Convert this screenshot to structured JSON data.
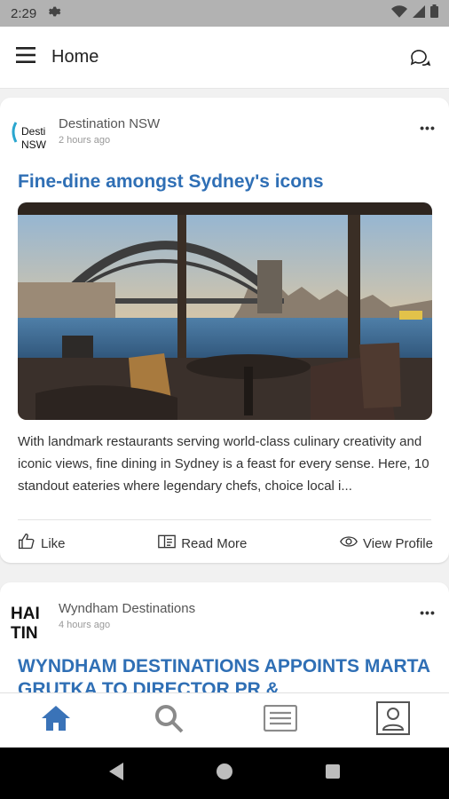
{
  "status_bar": {
    "time": "2:29"
  },
  "app_bar": {
    "title": "Home"
  },
  "feed": {
    "posts": [
      {
        "source": "Destination NSW",
        "logo_text": [
          "Desti",
          "NSW"
        ],
        "time": "2 hours ago",
        "title": "Fine-dine amongst Sydney's icons",
        "excerpt": "With landmark restaurants serving world-class culinary creativity and iconic views, fine dining in Sydney is a feast for every sense. Here, 10 standout eateries where legendary chefs, choice local i...",
        "actions": {
          "like": "Like",
          "read_more": "Read More",
          "view_profile": "View Profile"
        }
      },
      {
        "source": "Wyndham Destinations",
        "logo_text": [
          "HAI",
          "TIN"
        ],
        "time": "4 hours ago",
        "title": "WYNDHAM DESTINATIONS APPOINTS MARTA GRUTKA TO DIRECTOR PR &"
      }
    ]
  },
  "bottom_nav": {
    "items": [
      "home-icon",
      "search-icon",
      "news-list-icon",
      "profile-icon"
    ]
  },
  "colors": {
    "accent": "#2f6fb5",
    "nav_active": "#3a73b8",
    "nav_inactive": "#8a8a8a"
  }
}
